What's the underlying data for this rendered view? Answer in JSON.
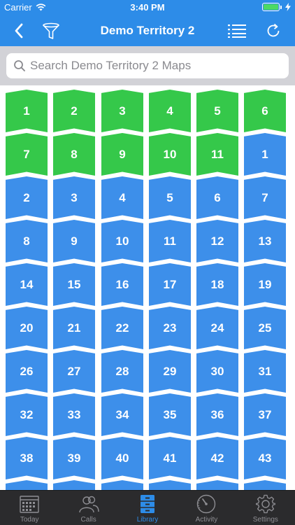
{
  "status_bar": {
    "carrier": "Carrier",
    "time": "3:40 PM"
  },
  "nav": {
    "title": "Demo Territory 2",
    "back_icon": "chevron-left-icon",
    "filter_icon": "funnel-icon",
    "list_icon": "list-icon",
    "refresh_icon": "refresh-icon"
  },
  "search": {
    "placeholder": "Search Demo Territory 2 Maps",
    "value": ""
  },
  "colors": {
    "bar": "#2d8ce8",
    "done": "#35c84a",
    "todo": "#3d8fea",
    "search_bg": "#d2d2d7",
    "tabbar": "#2b2b2d"
  },
  "tiles": [
    {
      "label": "1",
      "status": "done"
    },
    {
      "label": "2",
      "status": "done"
    },
    {
      "label": "3",
      "status": "done"
    },
    {
      "label": "4",
      "status": "done"
    },
    {
      "label": "5",
      "status": "done"
    },
    {
      "label": "6",
      "status": "done"
    },
    {
      "label": "7",
      "status": "done"
    },
    {
      "label": "8",
      "status": "done"
    },
    {
      "label": "9",
      "status": "done"
    },
    {
      "label": "10",
      "status": "done"
    },
    {
      "label": "11",
      "status": "done"
    },
    {
      "label": "1",
      "status": "todo"
    },
    {
      "label": "2",
      "status": "todo"
    },
    {
      "label": "3",
      "status": "todo"
    },
    {
      "label": "4",
      "status": "todo"
    },
    {
      "label": "5",
      "status": "todo"
    },
    {
      "label": "6",
      "status": "todo"
    },
    {
      "label": "7",
      "status": "todo"
    },
    {
      "label": "8",
      "status": "todo"
    },
    {
      "label": "9",
      "status": "todo"
    },
    {
      "label": "10",
      "status": "todo"
    },
    {
      "label": "11",
      "status": "todo"
    },
    {
      "label": "12",
      "status": "todo"
    },
    {
      "label": "13",
      "status": "todo"
    },
    {
      "label": "14",
      "status": "todo"
    },
    {
      "label": "15",
      "status": "todo"
    },
    {
      "label": "16",
      "status": "todo"
    },
    {
      "label": "17",
      "status": "todo"
    },
    {
      "label": "18",
      "status": "todo"
    },
    {
      "label": "19",
      "status": "todo"
    },
    {
      "label": "20",
      "status": "todo"
    },
    {
      "label": "21",
      "status": "todo"
    },
    {
      "label": "22",
      "status": "todo"
    },
    {
      "label": "23",
      "status": "todo"
    },
    {
      "label": "24",
      "status": "todo"
    },
    {
      "label": "25",
      "status": "todo"
    },
    {
      "label": "26",
      "status": "todo"
    },
    {
      "label": "27",
      "status": "todo"
    },
    {
      "label": "28",
      "status": "todo"
    },
    {
      "label": "29",
      "status": "todo"
    },
    {
      "label": "30",
      "status": "todo"
    },
    {
      "label": "31",
      "status": "todo"
    },
    {
      "label": "32",
      "status": "todo"
    },
    {
      "label": "33",
      "status": "todo"
    },
    {
      "label": "34",
      "status": "todo"
    },
    {
      "label": "35",
      "status": "todo"
    },
    {
      "label": "36",
      "status": "todo"
    },
    {
      "label": "37",
      "status": "todo"
    },
    {
      "label": "38",
      "status": "todo"
    },
    {
      "label": "39",
      "status": "todo"
    },
    {
      "label": "40",
      "status": "todo"
    },
    {
      "label": "41",
      "status": "todo"
    },
    {
      "label": "42",
      "status": "todo"
    },
    {
      "label": "43",
      "status": "todo"
    },
    {
      "label": "",
      "status": "todo"
    },
    {
      "label": "",
      "status": "todo"
    },
    {
      "label": "",
      "status": "todo"
    },
    {
      "label": "",
      "status": "todo"
    },
    {
      "label": "",
      "status": "todo"
    },
    {
      "label": "",
      "status": "todo"
    }
  ],
  "tabs": [
    {
      "label": "Today",
      "icon": "calendar-icon",
      "active": false
    },
    {
      "label": "Calls",
      "icon": "people-icon",
      "active": false
    },
    {
      "label": "Library",
      "icon": "cabinet-icon",
      "active": true
    },
    {
      "label": "Activity",
      "icon": "gauge-icon",
      "active": false
    },
    {
      "label": "Settings",
      "icon": "gear-icon",
      "active": false
    }
  ]
}
